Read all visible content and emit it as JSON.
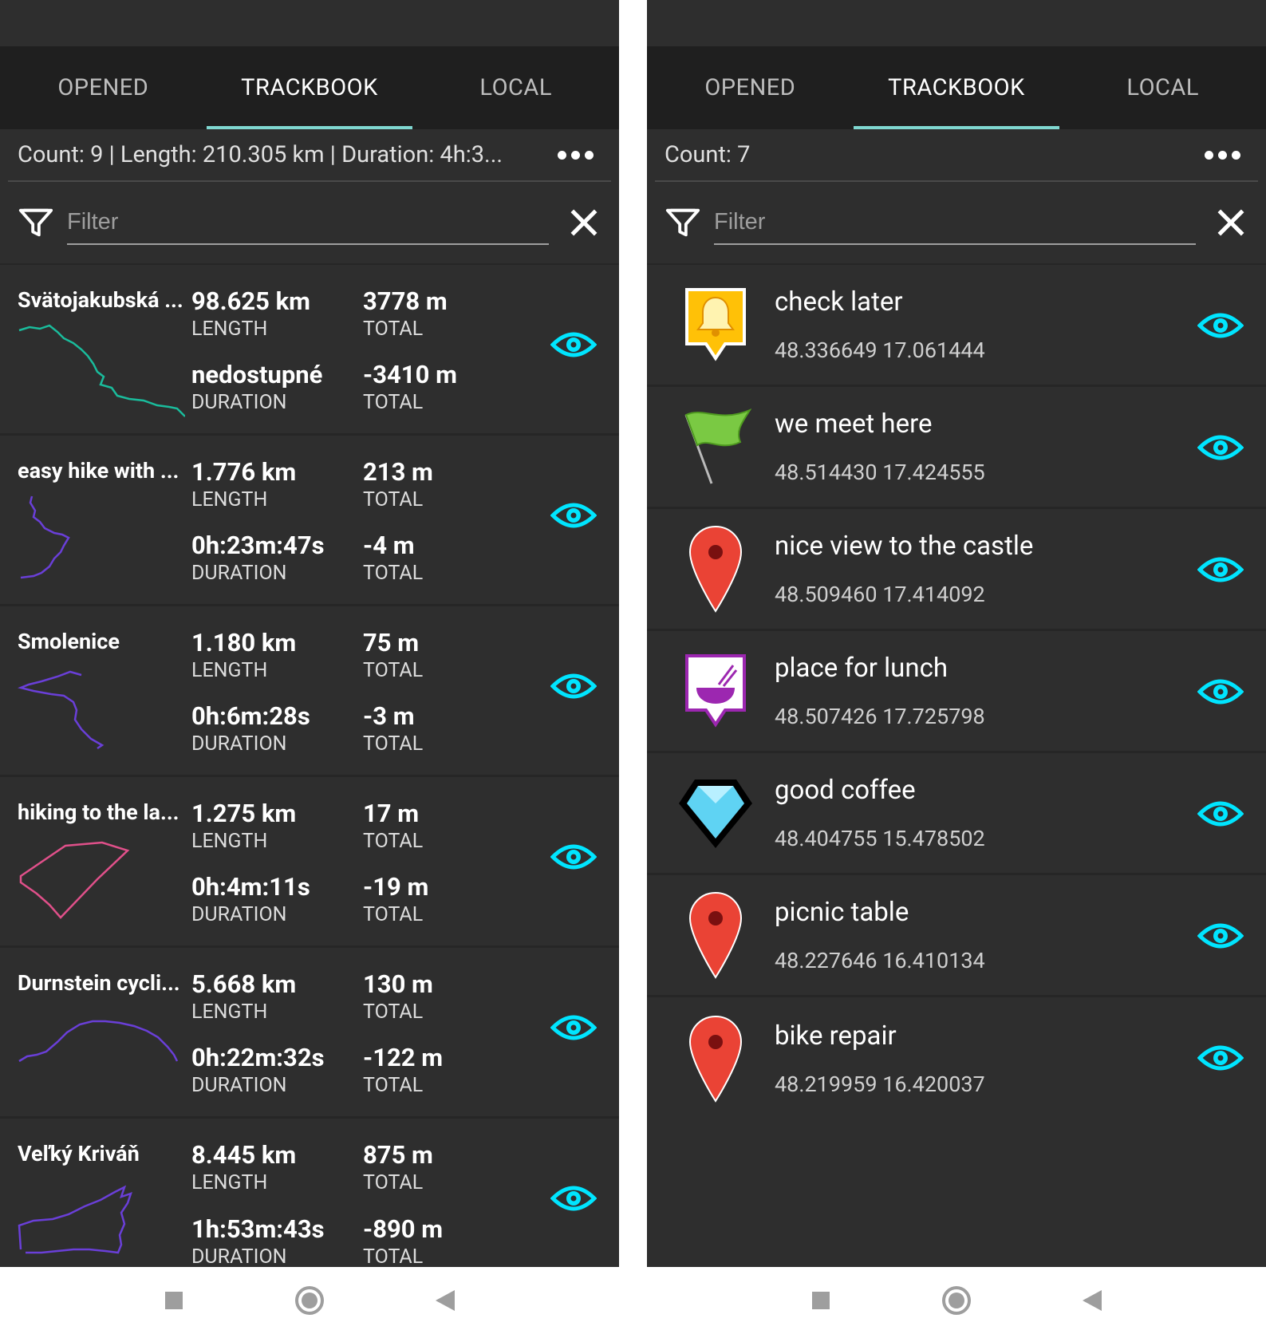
{
  "left": {
    "tabs": [
      "OPENED",
      "TRACKBOOK",
      "LOCAL"
    ],
    "summary": "Count: 9 | Length: 210.305 km | Duration: 4h:3...",
    "filter_placeholder": "Filter",
    "tracks": [
      {
        "name": "Svätojakubská ...",
        "length": "98.625 km",
        "length_label": "LENGTH",
        "elev_up": "3778 m",
        "elev_up_label": "TOTAL",
        "duration": "nedostupné",
        "duration_label": "DURATION",
        "elev_down": "-3410 m",
        "elev_down_label": "TOTAL",
        "color": "#1abc9c"
      },
      {
        "name": "easy hike with ...",
        "length": "1.776 km",
        "length_label": "LENGTH",
        "elev_up": "213 m",
        "elev_up_label": "TOTAL",
        "duration": "0h:23m:47s",
        "duration_label": "DURATION",
        "elev_down": "-4 m",
        "elev_down_label": "TOTAL",
        "color": "#6a3fd8"
      },
      {
        "name": "Smolenice",
        "length": "1.180 km",
        "length_label": "LENGTH",
        "elev_up": "75 m",
        "elev_up_label": "TOTAL",
        "duration": "0h:6m:28s",
        "duration_label": "DURATION",
        "elev_down": "-3 m",
        "elev_down_label": "TOTAL",
        "color": "#6a3fd8"
      },
      {
        "name": "hiking to the la...",
        "length": "1.275 km",
        "length_label": "LENGTH",
        "elev_up": "17 m",
        "elev_up_label": "TOTAL",
        "duration": "0h:4m:11s",
        "duration_label": "DURATION",
        "elev_down": "-19 m",
        "elev_down_label": "TOTAL",
        "color": "#e0508a"
      },
      {
        "name": "Durnstein cycli...",
        "length": "5.668 km",
        "length_label": "LENGTH",
        "elev_up": "130 m",
        "elev_up_label": "TOTAL",
        "duration": "0h:22m:32s",
        "duration_label": "DURATION",
        "elev_down": "-122 m",
        "elev_down_label": "TOTAL",
        "color": "#6a3fd8"
      },
      {
        "name": "Veľký Kriváň",
        "length": "8.445 km",
        "length_label": "LENGTH",
        "elev_up": "875 m",
        "elev_up_label": "TOTAL",
        "duration": "1h:53m:43s",
        "duration_label": "DURATION",
        "elev_down": "-890 m",
        "elev_down_label": "TOTAL",
        "color": "#6a3fd8"
      }
    ]
  },
  "right": {
    "tabs": [
      "OPENED",
      "TRACKBOOK",
      "LOCAL"
    ],
    "summary": "Count: 7",
    "filter_placeholder": "Filter",
    "points": [
      {
        "name": "check later",
        "coords": "48.336649 17.061444",
        "icon": "bell-icon"
      },
      {
        "name": "we meet here",
        "coords": "48.514430 17.424555",
        "icon": "flag-icon"
      },
      {
        "name": "nice view to the castle",
        "coords": "48.509460 17.414092",
        "icon": "pin-icon"
      },
      {
        "name": "place for lunch",
        "coords": "48.507426 17.725798",
        "icon": "bowl-icon"
      },
      {
        "name": "good coffee",
        "coords": "48.404755 15.478502",
        "icon": "diamond-icon"
      },
      {
        "name": "picnic table",
        "coords": "48.227646 16.410134",
        "icon": "pin-icon"
      },
      {
        "name": "bike repair",
        "coords": "48.219959 16.420037",
        "icon": "pin-icon"
      }
    ]
  },
  "colors": {
    "accent": "#00e5ff",
    "tab_indicator": "#7fd7d0",
    "background": "#2e2e2e",
    "tabbar": "#1f1f1f"
  }
}
